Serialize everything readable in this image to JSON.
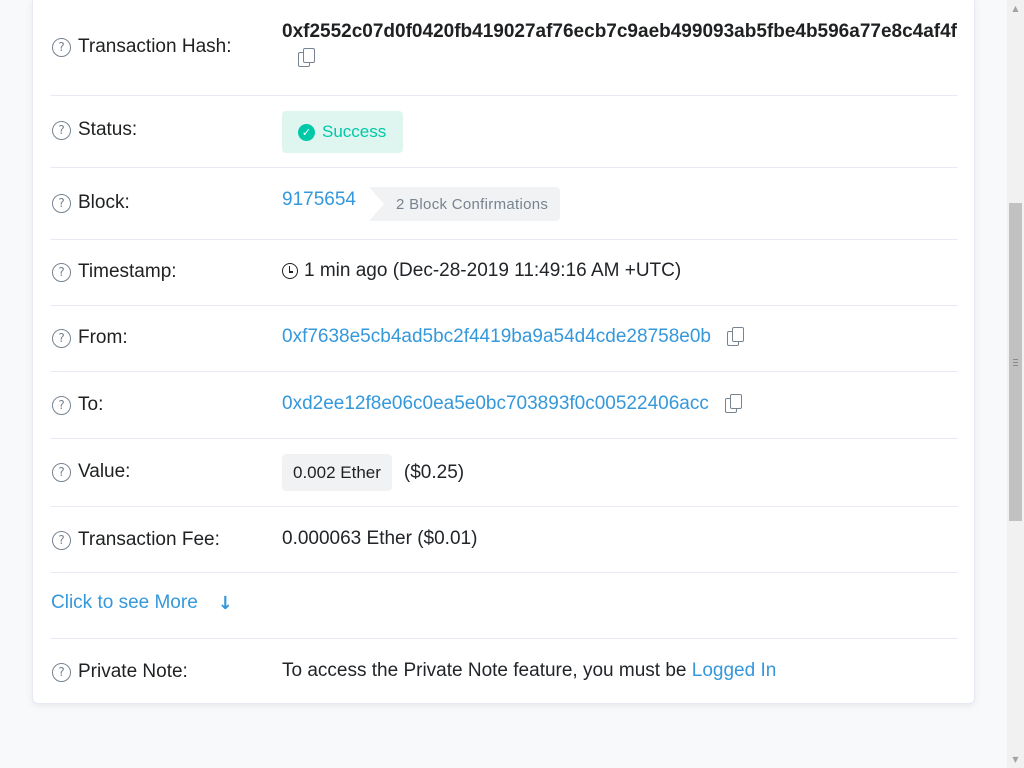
{
  "transaction": {
    "hash_label": "Transaction Hash:",
    "hash_value": "0xf2552c07d0f0420fb419027af76ecb7c9aeb499093ab5fbe4b596a77e8c4af4f",
    "status_label": "Status:",
    "status_value": "Success",
    "block_label": "Block:",
    "block_value": "9175654",
    "block_confirmations": "2 Block Confirmations",
    "timestamp_label": "Timestamp:",
    "timestamp_value": "1 min ago (Dec-28-2019 11:49:16 AM +UTC)",
    "from_label": "From:",
    "from_value": "0xf7638e5cb4ad5bc2f4419ba9a54d4cde28758e0b",
    "to_label": "To:",
    "to_value": "0xd2ee12f8e06c0ea5e0bc703893f0c00522406acc",
    "value_label": "Value:",
    "value_ether": "0.002 Ether",
    "value_usd": "($0.25)",
    "fee_label": "Transaction Fee:",
    "fee_value": "0.000063 Ether ($0.01)",
    "more_link": "Click to see More",
    "private_note_label": "Private Note:",
    "private_note_text": "To access the Private Note feature, you must be",
    "private_note_link": "Logged In"
  },
  "icons": {
    "help": "question-circle-icon",
    "copy": "copy-icon",
    "success": "check-circle-icon",
    "clock": "clock-icon",
    "arrow": "arrow-down-icon"
  },
  "colors": {
    "link": "#3498db",
    "success": "#00c9a7",
    "success_bg": "#def5f0",
    "muted": "#77838f",
    "border": "#e7eaf3"
  }
}
